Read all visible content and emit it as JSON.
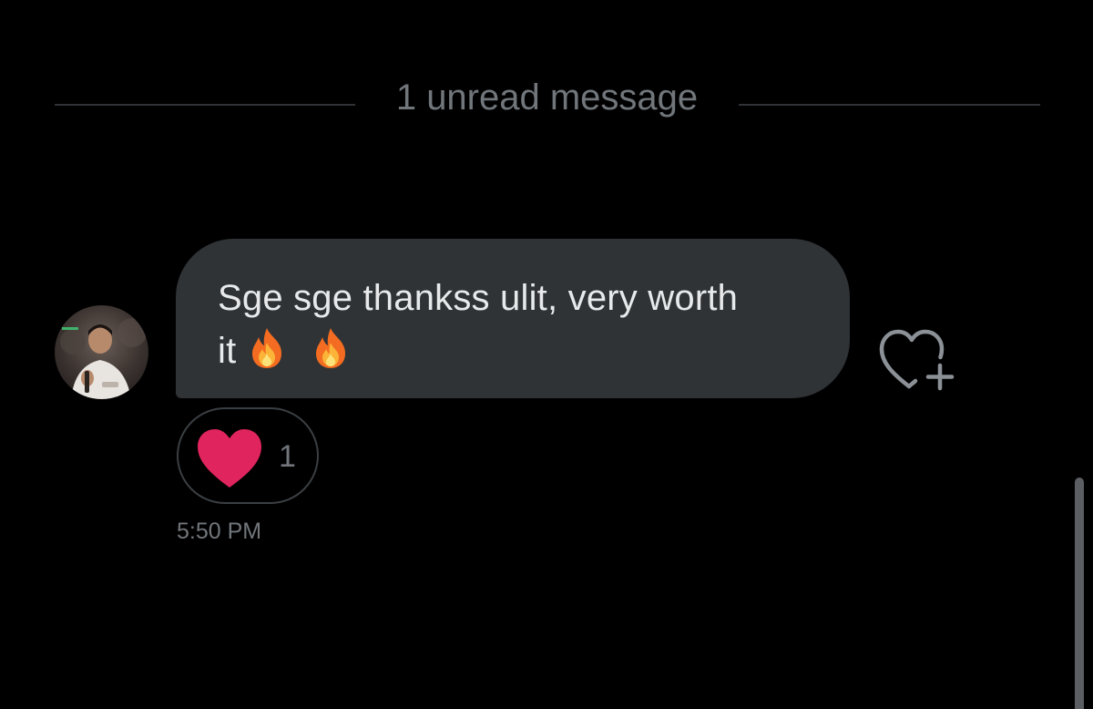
{
  "divider": {
    "label": "1 unread message"
  },
  "message": {
    "line1": "Sge sge thankss ulit, very worth",
    "line2": "it",
    "emojis": [
      "fire-emoji",
      "fire-emoji"
    ]
  },
  "reaction": {
    "icon": "heart-icon",
    "count": "1",
    "color": "#e0245e"
  },
  "timestamp": "5:50 PM",
  "react_button": {
    "icon": "heart-plus-icon"
  },
  "colors": {
    "background": "#000000",
    "bubble": "#2f3336",
    "text": "#e7e9ea",
    "muted": "#71767b"
  }
}
